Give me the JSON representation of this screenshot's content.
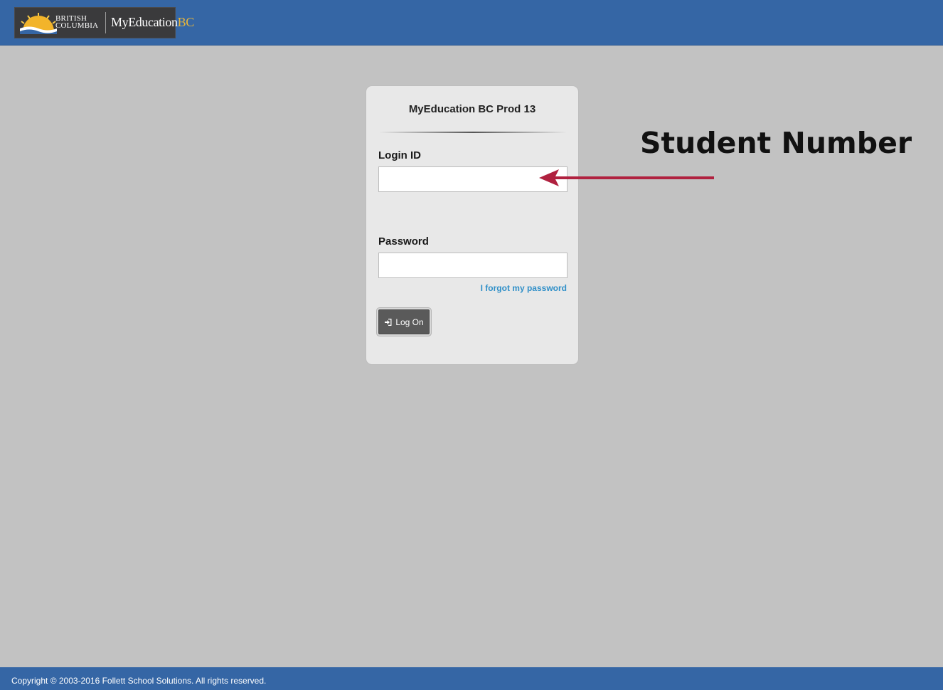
{
  "header": {
    "logo": {
      "province_line1": "BRITISH",
      "province_line2": "COLUMBIA",
      "app_name": "MyEducation",
      "app_suffix": "BC"
    }
  },
  "login_panel": {
    "title": "MyEducation BC Prod 13",
    "login_id_label": "Login ID",
    "login_id_value": "",
    "password_label": "Password",
    "password_value": "",
    "forgot_link": "I forgot my password",
    "logon_button": "Log On",
    "logon_icon": "sign-in-icon"
  },
  "annotation": {
    "text": "Student Number",
    "arrow_color": "#b0213f"
  },
  "footer": {
    "copyright": "Copyright © 2003-2016 Follett School Solutions. All rights reserved."
  },
  "colors": {
    "header_bg": "#3566a5",
    "page_bg": "#c2c2c2",
    "link": "#2f8fc8",
    "logo_accent": "#e8b53a"
  }
}
